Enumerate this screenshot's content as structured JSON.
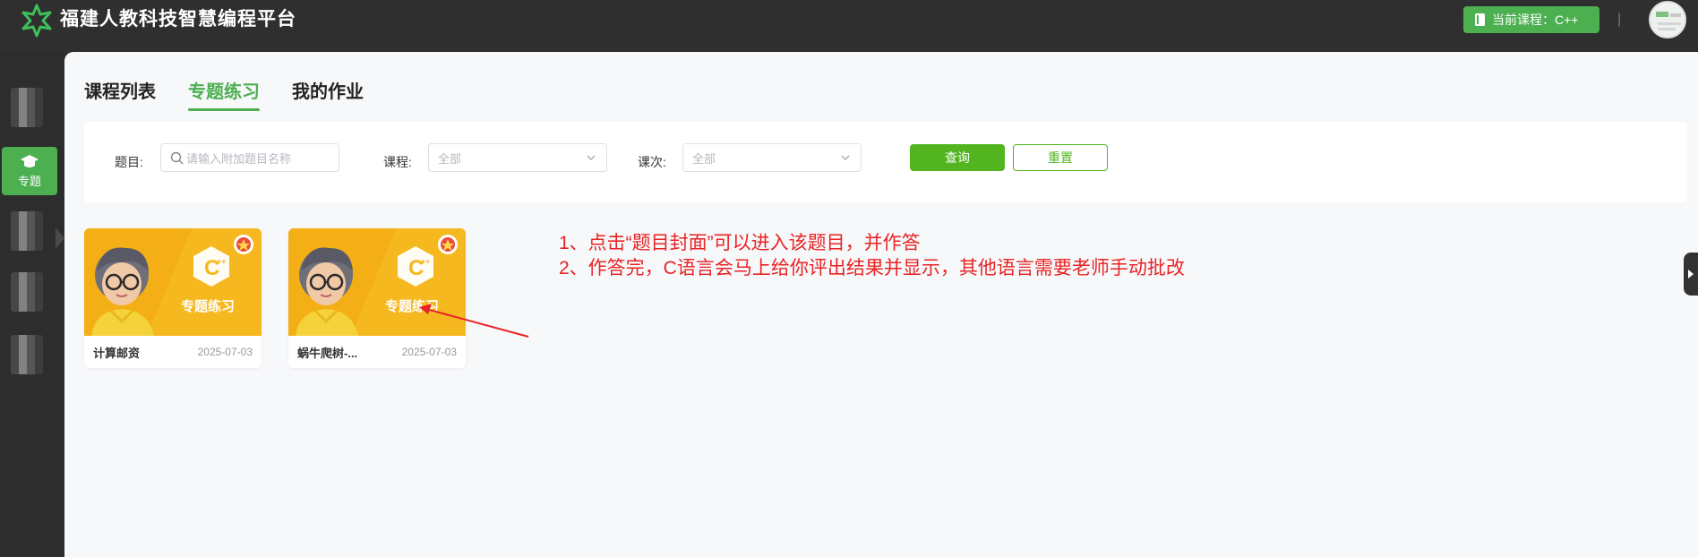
{
  "app": {
    "title": "福建人教科技智慧编程平台"
  },
  "header": {
    "current_course_label": "当前课程：C++",
    "separator": "|"
  },
  "sidenav": {
    "active_label": "专题"
  },
  "tabs": [
    {
      "label": "课程列表",
      "active": false
    },
    {
      "label": "专题练习",
      "active": true
    },
    {
      "label": "我的作业",
      "active": false
    }
  ],
  "filter": {
    "topic_label": "题目:",
    "topic_placeholder": "请输入附加题目名称",
    "course_label": "课程:",
    "course_value": "全部",
    "lesson_label": "课次:",
    "lesson_value": "全部",
    "query_label": "查询",
    "reset_label": "重置"
  },
  "cards": [
    {
      "name": "计算邮资",
      "date": "2025-07-03",
      "cover_text": "专题练习"
    },
    {
      "name": "蜗牛爬树-...",
      "date": "2025-07-03",
      "cover_text": "专题练习"
    }
  ],
  "annotation": {
    "line1": "1、点击“题目封面”可以进入该题目，并作答",
    "line2": "2、作答完，C语言会马上给你评出结果并显示，其他语言需要老师手动批改"
  },
  "colors": {
    "accent": "#4caf50",
    "note_red": "#e82424",
    "cover_yellow": "#f6b81f"
  }
}
